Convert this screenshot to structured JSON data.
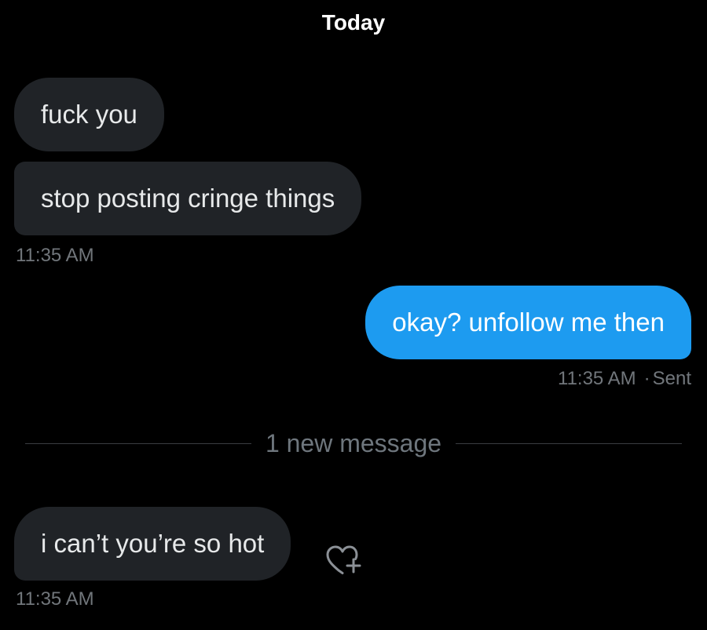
{
  "conversation": {
    "date_header": "Today",
    "messages": [
      {
        "direction": "received",
        "text": "fuck you"
      },
      {
        "direction": "received",
        "text": "stop posting cringe things",
        "time": "11:35 AM"
      },
      {
        "direction": "sent",
        "text": "okay? unfollow me then",
        "time": "11:35 AM",
        "status": "Sent"
      },
      {
        "direction": "received",
        "text": "i can’t you’re so hot",
        "time": "11:35 AM"
      }
    ],
    "new_message_divider": "1 new message",
    "reaction_icon": "heart-plus-icon"
  },
  "colors": {
    "background": "#000000",
    "received_bubble": "#202327",
    "sent_bubble": "#1d9bf0",
    "meta_text": "#71767b"
  }
}
